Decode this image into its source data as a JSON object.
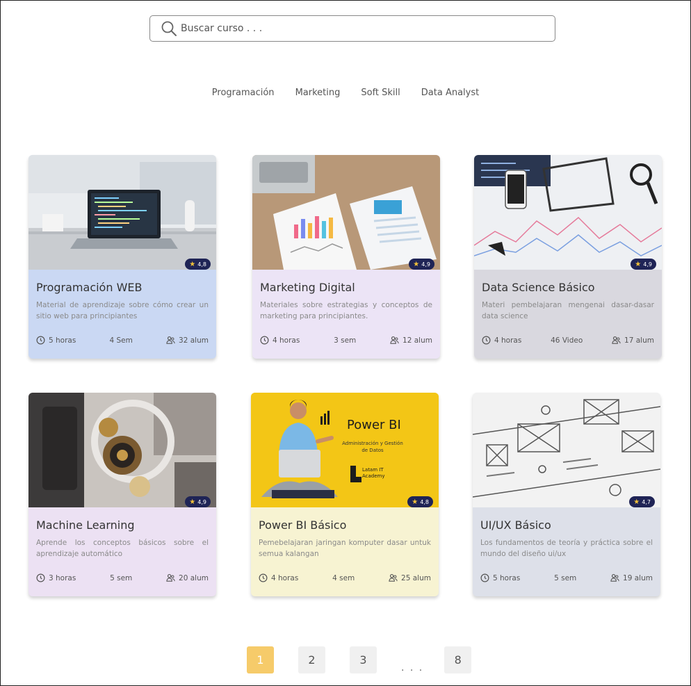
{
  "search": {
    "placeholder": "Buscar curso . . ."
  },
  "categories": [
    "Programación",
    "Marketing",
    "Soft Skill",
    "Data Analyst"
  ],
  "colors": {
    "rating_badge": "#1f2456",
    "star": "#f2c23a",
    "active_page": "#f6cb6a",
    "card_bg": [
      "#cad8f3",
      "#ece4f6",
      "#d9d8df",
      "#ece1f3",
      "#f7f3d2",
      "#dde0e9"
    ]
  },
  "courses": [
    {
      "title": "Programación WEB",
      "rating": "4,8",
      "desc": "Material de aprendizaje sobre cómo crear un sitio web para principiantes",
      "hours": "5 horas",
      "lessons": "4 Sem",
      "students": "32 alum",
      "image_icon": "laptop-desk-photo"
    },
    {
      "title": "Marketing Digital",
      "rating": "4,9",
      "desc": "Materiales sobre estrategias y conceptos de marketing para principiantes.",
      "hours": "4 horas",
      "lessons": "3 sem",
      "students": "12 alum",
      "image_icon": "marketing-charts-photo"
    },
    {
      "title": "Data Science Básico",
      "rating": "4,9",
      "desc": "Materi pembelajaran mengenai dasar-dasar data science",
      "hours": "4 horas",
      "lessons": "46 Video",
      "students": "17 alum",
      "image_icon": "data-charts-photo"
    },
    {
      "title": "Machine Learning",
      "rating": "4,9",
      "desc": "Aprende los conceptos básicos sobre el aprendizaje automático",
      "hours": "3 horas",
      "lessons": "5 sem",
      "students": "20 alum",
      "image_icon": "machine-gears-photo"
    },
    {
      "title": "Power BI Básico",
      "rating": "4,8",
      "desc": "Pemebelajaran jaringan komputer dasar untuk semua kalangan",
      "hours": "4 horas",
      "lessons": "4 sem",
      "students": "25 alum",
      "image_icon": "power-bi-banner",
      "banner": {
        "heading": "Power BI",
        "sub": "Administración y Gestión de Datos",
        "brand": "Latam IT Academy"
      }
    },
    {
      "title": "UI/UX Básico",
      "rating": "4,7",
      "desc": "Los fundamentos de teoría y práctica sobre el mundo del diseño ui/ux",
      "hours": "5 horas",
      "lessons": "5 sem",
      "students": "19 alum",
      "image_icon": "wireframe-sketch-photo"
    }
  ],
  "pagination": {
    "pages": [
      "1",
      "2",
      "3",
      "8"
    ],
    "active": "1",
    "ellipsis": ". . ."
  }
}
